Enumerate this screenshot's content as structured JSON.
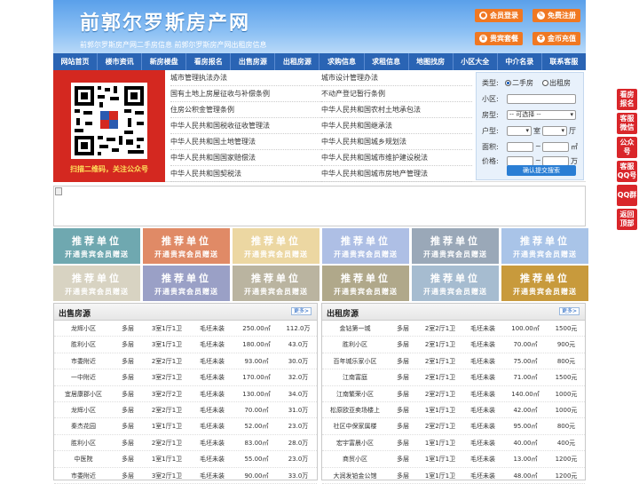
{
  "header": {
    "site_title": "前郭尔罗斯房产网",
    "site_sub": "前郭尔罗斯房产网二手房信息   前郭尔罗斯房产网出租房信息",
    "buttons": [
      "会员登录",
      "免费注册",
      "贵宾套餐",
      "金币充值"
    ]
  },
  "nav": [
    "网站首页",
    "楼市资讯",
    "新房楼盘",
    "看房报名",
    "出售房源",
    "出租房源",
    "求购信息",
    "求租信息",
    "地图找房",
    "小区大全",
    "中介名录",
    "联系客服"
  ],
  "qr": {
    "caption": "扫描二维码，关注公众号"
  },
  "laws_left": [
    "城市管理执法办法",
    "国有土地上房屋征收与补偿条例",
    "住房公积金管理条例",
    "中华人民共和国税收征收管理法",
    "中华人民共和国土地管理法",
    "中华人民共和国国家赔偿法",
    "中华人民共和国契税法"
  ],
  "laws_right": [
    "城市设计管理办法",
    "不动产登记暂行条例",
    "中华人民共和国农村土地承包法",
    "中华人民共和国继承法",
    "中华人民共和国城乡规划法",
    "中华人民共和国城市维护建设税法",
    "中华人民共和国城市房地产管理法"
  ],
  "search": {
    "type_label": "类型:",
    "type_options": [
      "二手房",
      "出租房"
    ],
    "community_label": "小区:",
    "housetype_label": "房型:",
    "housetype_value": "-- 可选择 --",
    "layout_label": "户型:",
    "room_unit": "室",
    "hall_unit": "厅",
    "area_label": "面积:",
    "area_unit": "㎡",
    "price_label": "价格:",
    "price_sep": "~",
    "price_unit": "万",
    "submit": "确认提交搜索"
  },
  "ads": {
    "t1": "推荐单位",
    "t2": "开通贵宾会员赠送",
    "colors": [
      "#6fa8b0",
      "#e08a66",
      "#ecd7a2",
      "#aebfe5",
      "#9aa8b8",
      "#a9c4e8",
      "#d8d3c2",
      "#9aa0c6",
      "#bab4a0",
      "#b0a88a",
      "#a6bcd0",
      "#c89a3c"
    ]
  },
  "sale": {
    "title": "出售房源",
    "more": "更多>",
    "rows": [
      [
        "龙辉小区",
        "多层",
        "3室1厅1卫",
        "毛坯未装",
        "250.00㎡",
        "112.0万"
      ],
      [
        "胜利小区",
        "多层",
        "3室1厅1卫",
        "毛坯未装",
        "180.00㎡",
        "43.0万"
      ],
      [
        "市委附近",
        "多层",
        "2室2厅1卫",
        "毛坯未装",
        "93.00㎡",
        "30.0万"
      ],
      [
        "一中附近",
        "多层",
        "3室2厅1卫",
        "毛坯未装",
        "170.00㎡",
        "32.0万"
      ],
      [
        "宜居康郡小区",
        "多层",
        "3室2厅2卫",
        "毛坯未装",
        "130.00㎡",
        "34.0万"
      ],
      [
        "龙辉小区",
        "多层",
        "2室2厅1卫",
        "毛坯未装",
        "70.00㎡",
        "31.0万"
      ],
      [
        "秦杰花园",
        "多层",
        "1室1厅1卫",
        "毛坯未装",
        "52.00㎡",
        "23.0万"
      ],
      [
        "胜利小区",
        "多层",
        "2室2厅1卫",
        "毛坯未装",
        "83.00㎡",
        "28.0万"
      ],
      [
        "中医院",
        "多层",
        "1室1厅1卫",
        "毛坯未装",
        "55.00㎡",
        "23.0万"
      ],
      [
        "市委附近",
        "多层",
        "3室2厅1卫",
        "毛坯未装",
        "90.00㎡",
        "33.0万"
      ]
    ]
  },
  "rent": {
    "title": "出租房源",
    "more": "更多>",
    "rows": [
      [
        "金钻第一城",
        "多层",
        "2室2厅1卫",
        "毛坯未装",
        "100.00㎡",
        "1500元"
      ],
      [
        "胜利小区",
        "多层",
        "2室1厅1卫",
        "毛坯未装",
        "70.00㎡",
        "900元"
      ],
      [
        "百年城乐家小区",
        "多层",
        "2室1厅1卫",
        "毛坯未装",
        "75.00㎡",
        "800元"
      ],
      [
        "江南富庭",
        "多层",
        "2室1厅1卫",
        "毛坯未装",
        "71.00㎡",
        "1500元"
      ],
      [
        "江南繁荣小区",
        "多层",
        "2室2厅1卫",
        "毛坯未装",
        "140.00㎡",
        "1000元"
      ],
      [
        "松原欧亚卖场楼上",
        "多层",
        "1室1厅1卫",
        "毛坯未装",
        "42.00㎡",
        "1000元"
      ],
      [
        "社区中保家属楼",
        "多层",
        "2室2厅1卫",
        "毛坯未装",
        "95.00㎡",
        "800元"
      ],
      [
        "宏宇富晨小区",
        "多层",
        "1室1厅1卫",
        "毛坯未装",
        "40.00㎡",
        "400元"
      ],
      [
        "商贸小区",
        "多层",
        "1室1厅1卫",
        "毛坯未装",
        "13.00㎡",
        "1200元"
      ],
      [
        "大润发铂金公馆",
        "多层",
        "1室1厅1卫",
        "毛坯未装",
        "48.00㎡",
        "1200元"
      ]
    ]
  },
  "float": [
    "看房报名",
    "客服微信",
    "公众号",
    "客服QQ号",
    "QQ群",
    "返回顶部"
  ]
}
